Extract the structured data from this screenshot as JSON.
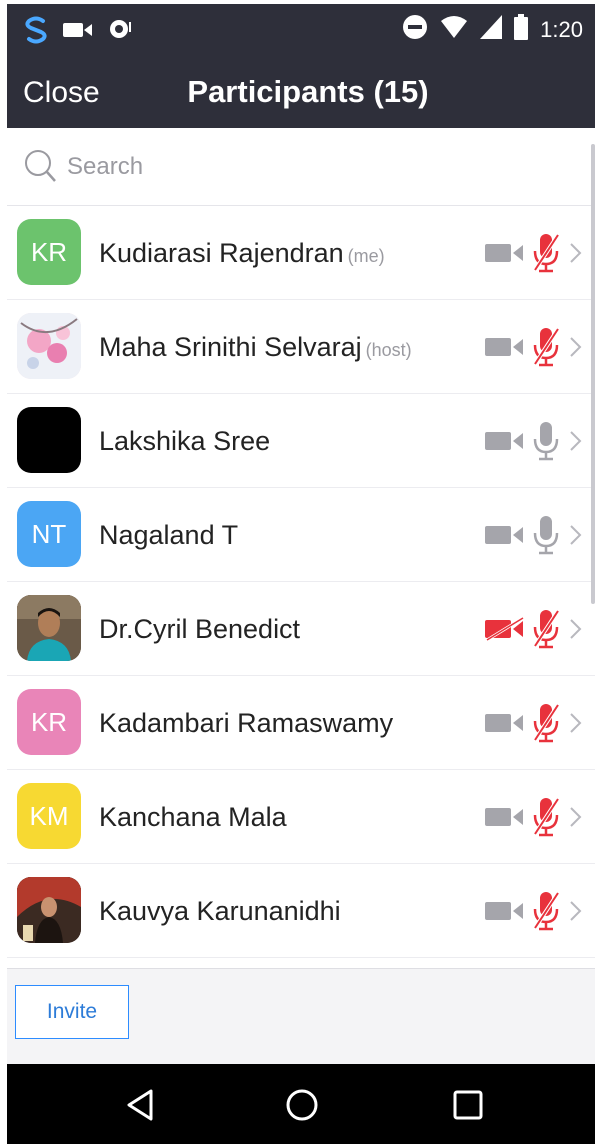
{
  "status_bar": {
    "time": "1:20"
  },
  "header": {
    "close_label": "Close",
    "title": "Participants (15)"
  },
  "search": {
    "placeholder": "Search"
  },
  "participants": [
    {
      "name": "Kudiarasi Rajendran",
      "tag": "(me)",
      "initials": "KR",
      "avatar_color": "#6cc36d",
      "video_muted": true,
      "audio_muted": true
    },
    {
      "name": "Maha Srinithi Selvaraj",
      "tag": "(host)",
      "initials": "",
      "avatar_color": "#f2dbe4",
      "video_muted": true,
      "audio_muted": true
    },
    {
      "name": "Lakshika Sree",
      "tag": "",
      "initials": "",
      "avatar_color": "#000000",
      "video_muted": true,
      "audio_muted": false
    },
    {
      "name": "Nagaland T",
      "tag": "",
      "initials": "NT",
      "avatar_color": "#4ba6f4",
      "video_muted": true,
      "audio_muted": false
    },
    {
      "name": "Dr.Cyril Benedict",
      "tag": "",
      "initials": "",
      "avatar_color": "#5a4a3a",
      "video_muted": true,
      "audio_muted": true,
      "video_red": true
    },
    {
      "name": "Kadambari Ramaswamy",
      "tag": "",
      "initials": "KR",
      "avatar_color": "#e985b8",
      "video_muted": true,
      "audio_muted": true
    },
    {
      "name": "Kanchana Mala",
      "tag": "",
      "initials": "KM",
      "avatar_color": "#f7d932",
      "video_muted": true,
      "audio_muted": true
    },
    {
      "name": "Kauvya Karunanidhi",
      "tag": "",
      "initials": "",
      "avatar_color": "#3b2a22",
      "video_muted": true,
      "audio_muted": true
    }
  ],
  "footer": {
    "invite_label": "Invite"
  },
  "colors": {
    "header_bg": "#2e2f3a",
    "muted_red": "#e8323c",
    "icon_gray": "#a5a5ab",
    "accent_blue": "#2d8cff"
  }
}
